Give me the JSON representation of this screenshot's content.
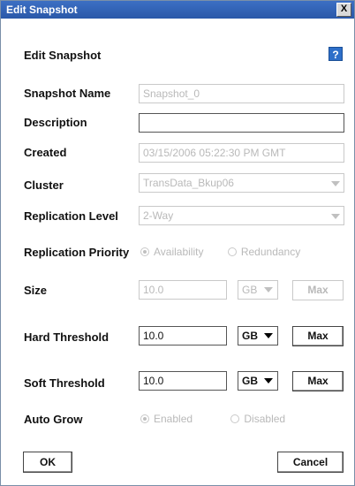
{
  "window": {
    "title": "Edit Snapshot",
    "close_label": "X"
  },
  "heading": "Edit Snapshot",
  "help_label": "?",
  "fields": {
    "snapshot_name": {
      "label": "Snapshot Name",
      "value": "Snapshot_0"
    },
    "description": {
      "label": "Description",
      "value": ""
    },
    "created": {
      "label": "Created",
      "value": "03/15/2006 05:22:30 PM GMT"
    },
    "cluster": {
      "label": "Cluster",
      "value": "TransData_Bkup06"
    },
    "replication_level": {
      "label": "Replication Level",
      "value": "2-Way"
    },
    "replication_priority": {
      "label": "Replication Priority",
      "options": [
        "Availability",
        "Redundancy"
      ],
      "selected": "Availability"
    },
    "size": {
      "label": "Size",
      "value": "10.0",
      "unit": "GB",
      "max_label": "Max"
    },
    "hard_threshold": {
      "label": "Hard Threshold",
      "value": "10.0",
      "unit": "GB",
      "max_label": "Max"
    },
    "soft_threshold": {
      "label": "Soft Threshold",
      "value": "10.0",
      "unit": "GB",
      "max_label": "Max"
    },
    "auto_grow": {
      "label": "Auto Grow",
      "options": [
        "Enabled",
        "Disabled"
      ],
      "selected": "Enabled"
    }
  },
  "buttons": {
    "ok": "OK",
    "cancel": "Cancel"
  }
}
